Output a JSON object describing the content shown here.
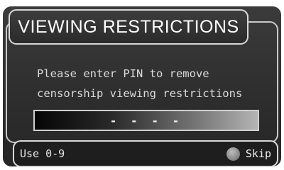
{
  "dialog": {
    "title": "VIEWING RESTRICTIONS",
    "message_lines": [
      "Please enter PIN to remove",
      "censorship viewing restrictions"
    ],
    "pin_field": {
      "value": "- - - -"
    }
  },
  "footer": {
    "hint": "Use 0-9",
    "skip_label": "Skip",
    "skip_icon": "grey-circle-button-icon"
  },
  "colors": {
    "background": "#2e2e2e",
    "border": "#d8d8d8",
    "text": "#ffffff",
    "skip_button": "#8a8a8a"
  }
}
